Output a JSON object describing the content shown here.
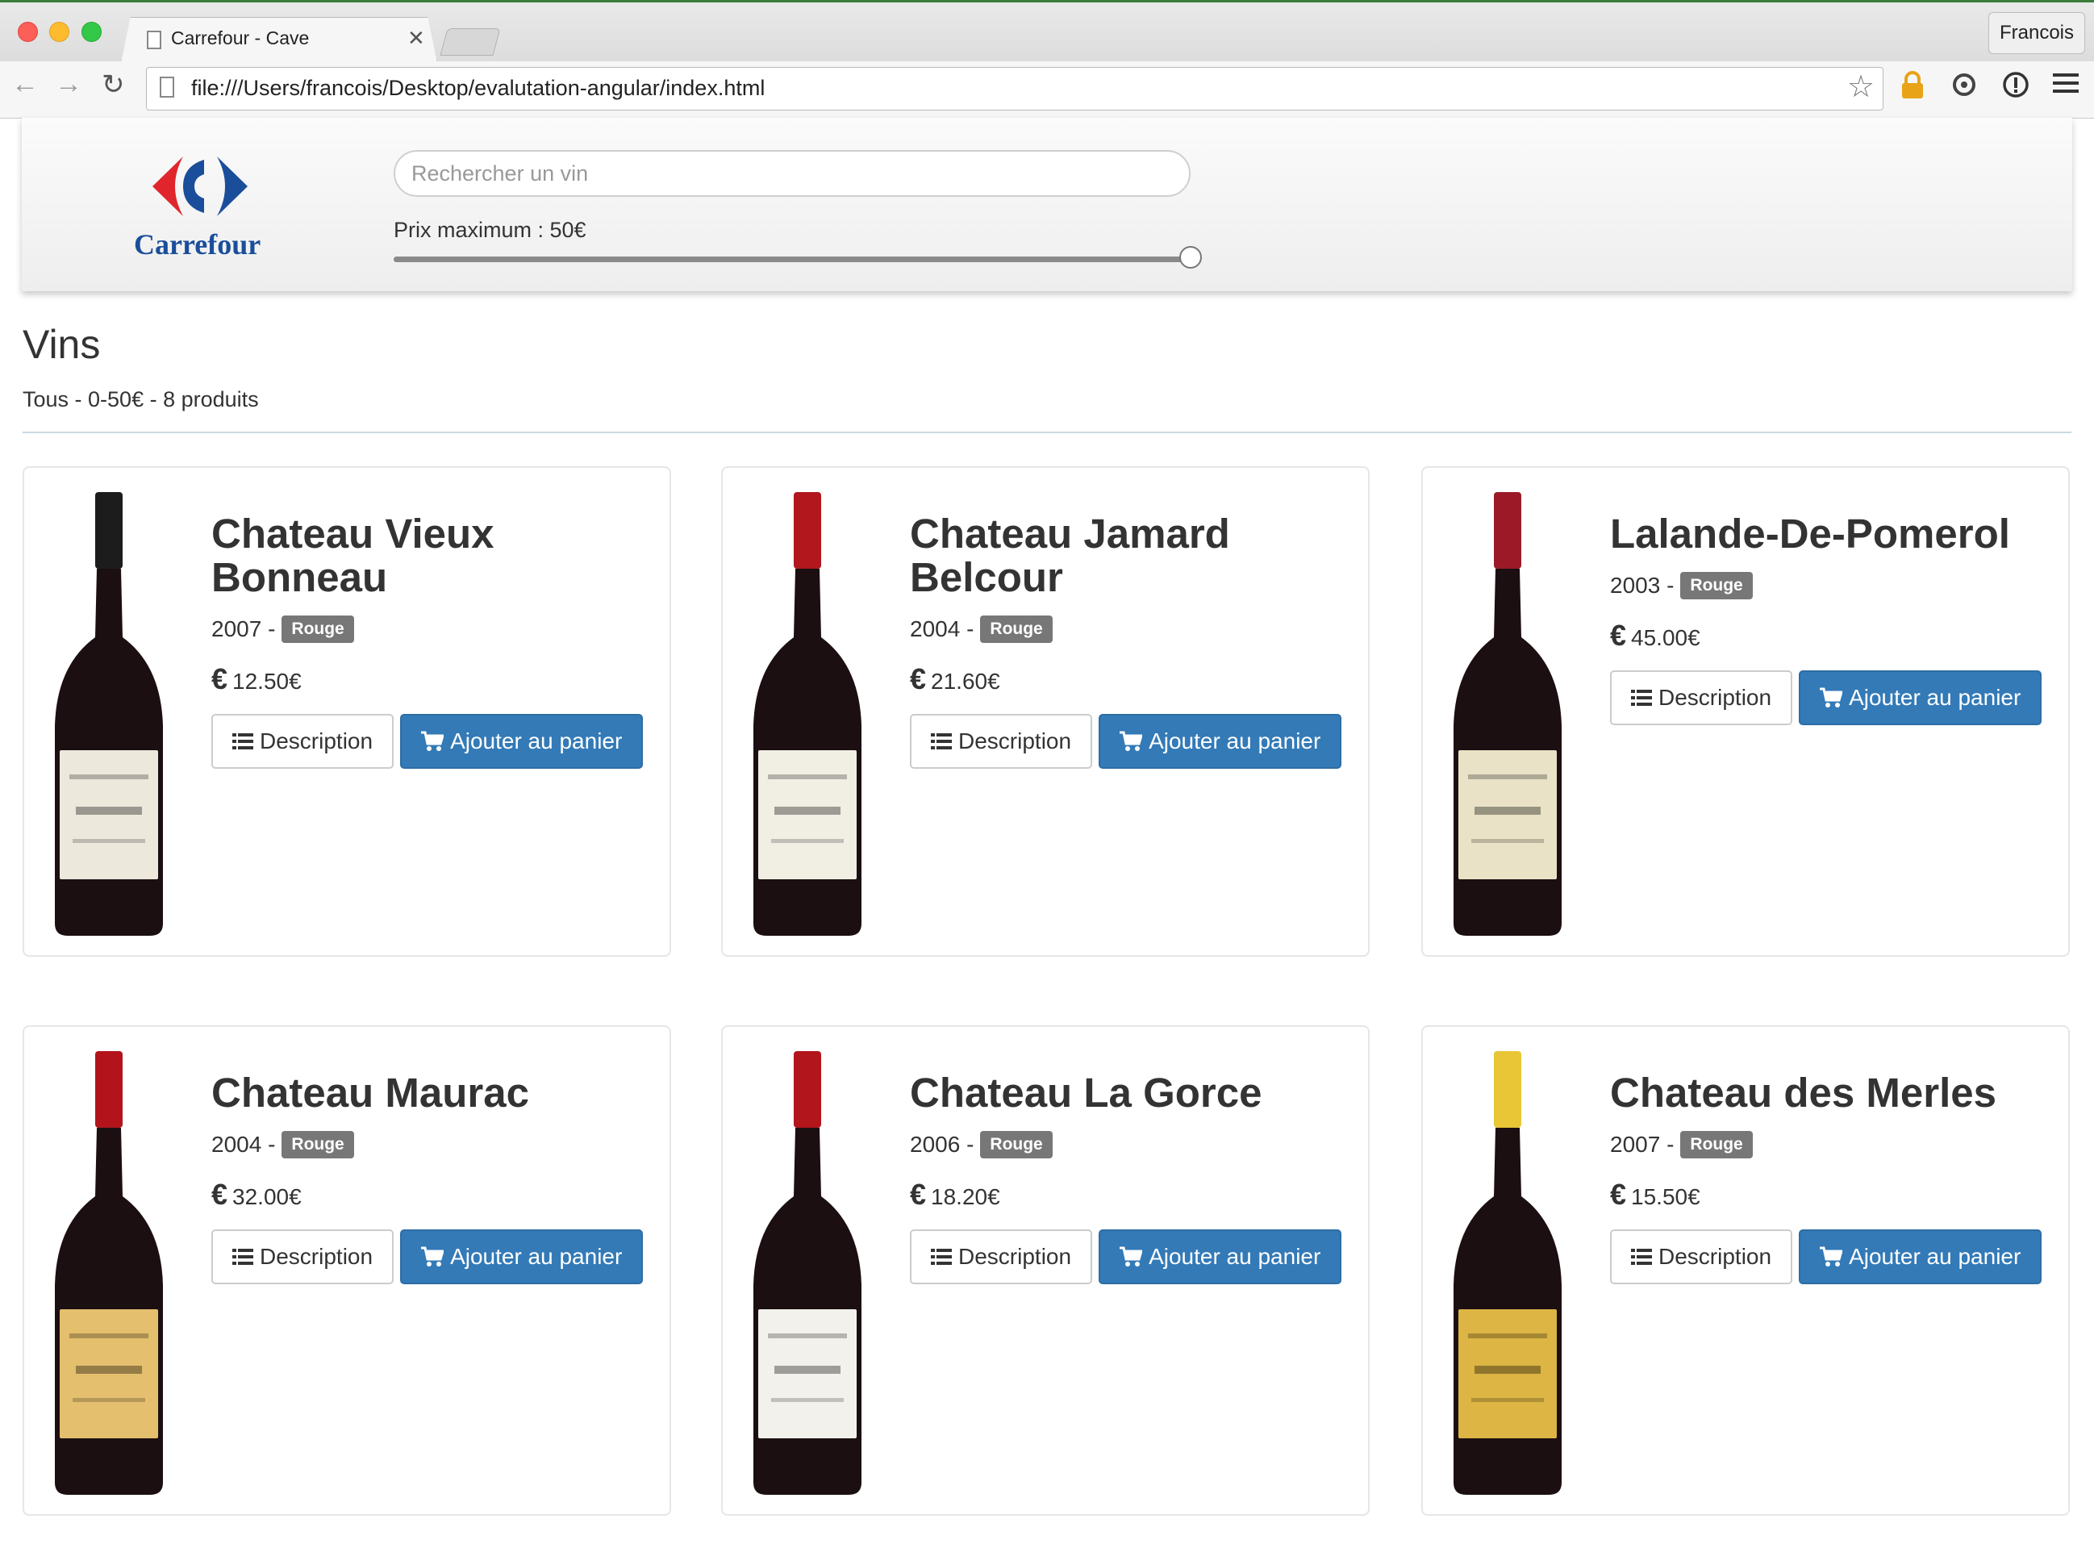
{
  "browser": {
    "tab_title": "Carrefour - Cave",
    "url": "file:///Users/francois/Desktop/evalutation-angular/index.html",
    "profile_name": "Francois"
  },
  "header": {
    "logo_text": "Carrefour",
    "search_placeholder": "Rechercher un vin",
    "search_value": "",
    "price_label": "Prix maximum : 50€",
    "price_max": 50
  },
  "main": {
    "title": "Vins",
    "summary": "Tous - 0-50€ - 8 produits"
  },
  "labels": {
    "description_button": "Description",
    "cart_button": "Ajouter au panier"
  },
  "wines": [
    {
      "name": "Chateau Vieux Bonneau",
      "year": "2007 -",
      "type": "Rouge",
      "price": "12.50€",
      "capsule": "#1c1c1c",
      "label_color": "#ece8dc"
    },
    {
      "name": "Chateau Jamard Belcour",
      "year": "2004 -",
      "type": "Rouge",
      "price": "21.60€",
      "capsule": "#b1171d",
      "label_color": "#f1eee4"
    },
    {
      "name": "Lalande-De-Pomerol",
      "year": "2003 -",
      "type": "Rouge",
      "price": "45.00€",
      "capsule": "#9c1a28",
      "label_color": "#e9e2c6"
    },
    {
      "name": "Chateau Maurac",
      "year": "2004 -",
      "type": "Rouge",
      "price": "32.00€",
      "capsule": "#b3141c",
      "label_color": "#e3bf6e"
    },
    {
      "name": "Chateau La Gorce",
      "year": "2006 -",
      "type": "Rouge",
      "price": "18.20€",
      "capsule": "#b2151c",
      "label_color": "#f3f1ec"
    },
    {
      "name": "Chateau des Merles",
      "year": "2007 -",
      "type": "Rouge",
      "price": "15.50€",
      "capsule": "#e8c636",
      "label_color": "#dcb544"
    }
  ],
  "colors": {
    "primary_button": "#337ab7",
    "badge": "#777777",
    "brand_blue": "#1a4e9a",
    "brand_red": "#e0262c"
  }
}
